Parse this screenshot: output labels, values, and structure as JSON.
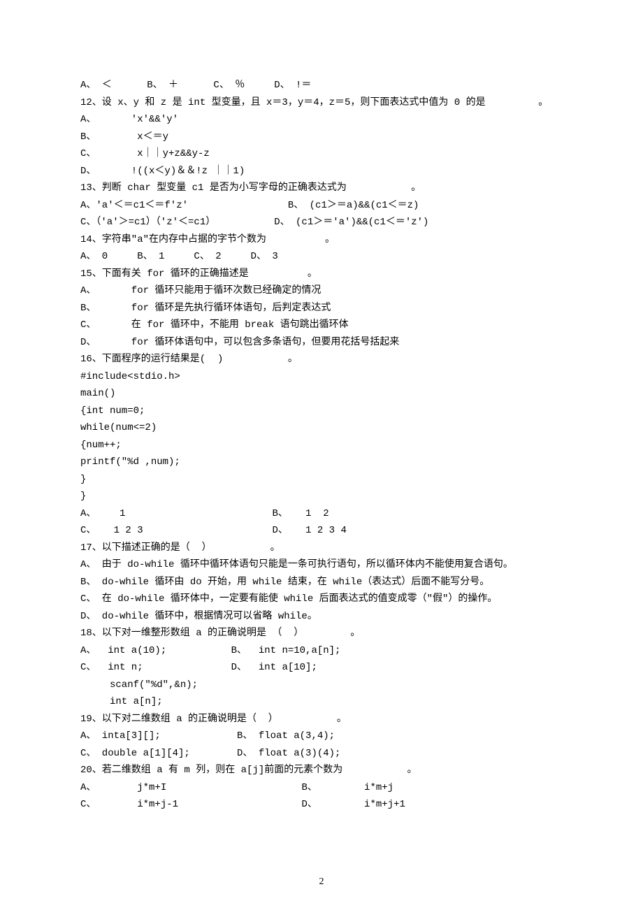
{
  "q11_options": "A、 ＜      B、 ＋      C、 ％     D、 !＝",
  "q12": {
    "stem": "12、设 x、y 和 z 是 int 型变量，且 x＝3，y＝4，z＝5，则下面表达式中值为 0 的是         。",
    "a": "A、      'x'&&'y'",
    "b": "B、       x＜＝y",
    "c": "C、       x｜｜y+z&&y-z",
    "d": "D、      !((x＜y)＆＆!z ｜｜1)"
  },
  "q13": {
    "stem": "13、判断 char 型变量 c1 是否为小写字母的正确表达式为           。",
    "row1": "A、'a'＜＝c1＜＝f'z'                 B、 (c1＞＝a)&&(c1＜＝z)",
    "row2": "C、（'a'＞=c1）（'z'＜=c1）          D、 (c1＞＝'a')&&(c1＜＝'z')"
  },
  "q14": {
    "stem": "14、字符串\"a\"在内存中占据的字节个数为          。",
    "opts": "A、 0     B、 1     C、 2     D、 3"
  },
  "q15": {
    "stem": "15、下面有关 for 循环的正确描述是          。",
    "a": "A、      for 循环只能用于循环次数已经确定的情况",
    "b": "B、      for 循环是先执行循环体语句，后判定表达式",
    "c": "C、      在 for 循环中，不能用 break 语句跳出循环体",
    "d": "D、      for 循环体语句中，可以包含多条语句，但要用花括号括起来"
  },
  "q16": {
    "stem": "16、下面程序的运行结果是(  )           。",
    "code": [
      "#include<stdio.h>",
      "main()",
      "{int num=0;",
      "while(num<=2)",
      "{num++;",
      "printf(\"%d ,num);",
      "}",
      "}"
    ],
    "row1": "A、    1                         B、   1  2",
    "row2": "C、   1 2 3                      D、   1 2 3 4"
  },
  "q17": {
    "stem": "17、以下描述正确的是（  ）          。",
    "a": "A、 由于 do-while 循环中循环体语句只能是一条可执行语句，所以循环体内不能使用复合语句。",
    "b": "B、 do-while 循环由 do 开始，用 while 结束，在 while（表达式）后面不能写分号。",
    "c": "C、 在 do-while 循环体中，一定要有能使 while 后面表达式的值变成零（\"假\"）的操作。",
    "d": "D、 do-while 循环中，根据情况可以省略 while。"
  },
  "q18": {
    "stem": "18、以下对一维整形数组 a 的正确说明是 （  ）        。",
    "row1": "A、  int a(10);           B、  int n=10,a[n];",
    "row2": "C、  int n;               D、  int a[10];",
    "row3": "     scanf(\"%d\",&n);",
    "row4": "     int a[n];"
  },
  "q19": {
    "stem": "19、以下对二维数组 a 的正确说明是（  ）          。",
    "row1": "A、 inta[3][];             B、 float a(3,4);",
    "row2": "C、 double a[1][4];        D、 float a(3)(4);"
  },
  "q20": {
    "stem": "20、若二维数组 a 有 m 列，则在 a[j]前面的元素个数为           。",
    "row1": "A、       j*m+I                       B、        i*m+j",
    "row2": "C、       i*m+j-1                     D、        i*m+j+1"
  },
  "page_number": "2"
}
